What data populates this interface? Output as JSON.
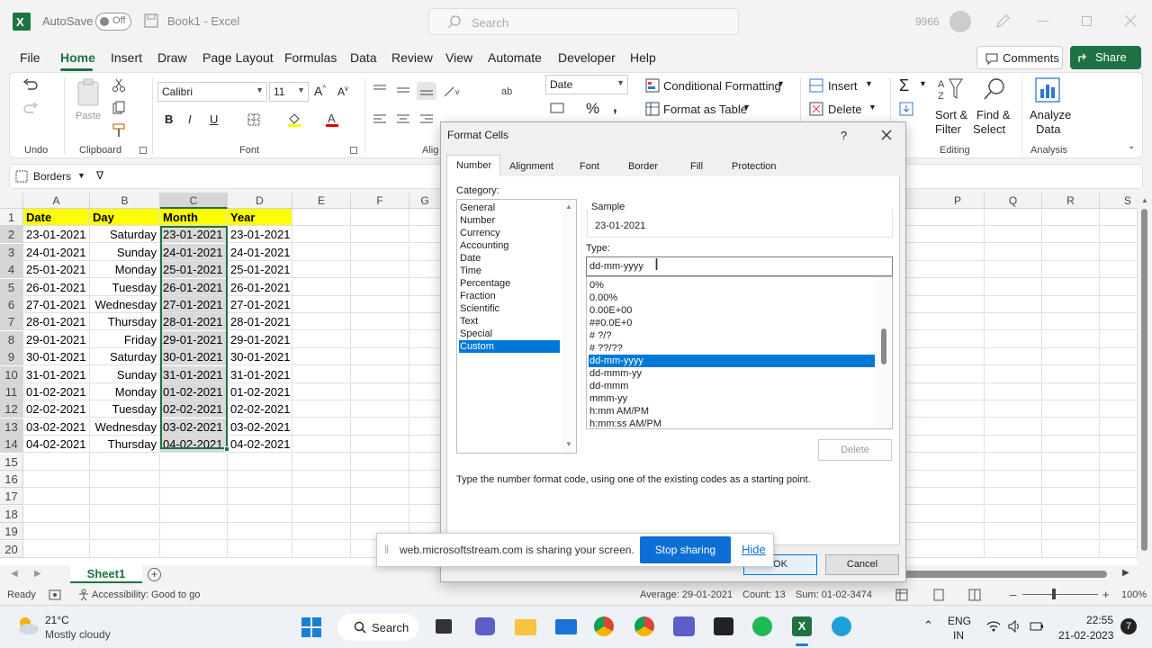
{
  "titlebar": {
    "autosave": "AutoSave",
    "toggle": "Off",
    "doc_title": "Book1 - Excel",
    "search_placeholder": "Search",
    "user_num": "9966"
  },
  "menu": [
    "File",
    "Home",
    "Insert",
    "Draw",
    "Page Layout",
    "Formulas",
    "Data",
    "Review",
    "View",
    "Automate",
    "Developer",
    "Help"
  ],
  "menu_right": {
    "comments": "Comments",
    "share": "Share"
  },
  "ribbon": {
    "undo_group": "Undo",
    "clipboard_group": "Clipboard",
    "paste": "Paste",
    "font_group": "Font",
    "font_name": "Calibri",
    "font_size": "11",
    "align_group": "Alig",
    "number_format": "Date",
    "cond_format": "Conditional Formatting",
    "format_table": "Format as Table",
    "insert": "Insert",
    "delete": "Delete",
    "sort_filter_1": "Sort &",
    "sort_filter_2": "Filter",
    "find_1": "Find &",
    "find_2": "Select",
    "editing_group": "Editing",
    "analyze_1": "Analyze",
    "analyze_2": "Data",
    "analysis_group": "Analysis",
    "bold": "B",
    "italic": "I",
    "underline": "U"
  },
  "formulabar": {
    "borders": "Borders"
  },
  "grid": {
    "columns": [
      "A",
      "B",
      "C",
      "D",
      "E",
      "F",
      "G",
      "P",
      "Q",
      "R",
      "S"
    ],
    "rows": [
      "1",
      "2",
      "3",
      "4",
      "5",
      "6",
      "7",
      "8",
      "9",
      "10",
      "11",
      "12",
      "13",
      "14",
      "15",
      "16",
      "17",
      "18",
      "19",
      "20"
    ],
    "headers": [
      "Date",
      "Day",
      "Month",
      "Year"
    ],
    "data": [
      [
        "23-01-2021",
        "Saturday",
        "23-01-2021",
        "23-01-2021"
      ],
      [
        "24-01-2021",
        "Sunday",
        "24-01-2021",
        "24-01-2021"
      ],
      [
        "25-01-2021",
        "Monday",
        "25-01-2021",
        "25-01-2021"
      ],
      [
        "26-01-2021",
        "Tuesday",
        "26-01-2021",
        "26-01-2021"
      ],
      [
        "27-01-2021",
        "Wednesday",
        "27-01-2021",
        "27-01-2021"
      ],
      [
        "28-01-2021",
        "Thursday",
        "28-01-2021",
        "28-01-2021"
      ],
      [
        "29-01-2021",
        "Friday",
        "29-01-2021",
        "29-01-2021"
      ],
      [
        "30-01-2021",
        "Saturday",
        "30-01-2021",
        "30-01-2021"
      ],
      [
        "31-01-2021",
        "Sunday",
        "31-01-2021",
        "31-01-2021"
      ],
      [
        "01-02-2021",
        "Monday",
        "01-02-2021",
        "01-02-2021"
      ],
      [
        "02-02-2021",
        "Tuesday",
        "02-02-2021",
        "02-02-2021"
      ],
      [
        "03-02-2021",
        "Wednesday",
        "03-02-2021",
        "03-02-2021"
      ],
      [
        "04-02-2021",
        "Thursday",
        "04-02-2021",
        "04-02-2021"
      ]
    ]
  },
  "dialog": {
    "title": "Format Cells",
    "help": "?",
    "tabs": [
      "Number",
      "Alignment",
      "Font",
      "Border",
      "Fill",
      "Protection"
    ],
    "category_label": "Category:",
    "categories": [
      "General",
      "Number",
      "Currency",
      "Accounting",
      "Date",
      "Time",
      "Percentage",
      "Fraction",
      "Scientific",
      "Text",
      "Special",
      "Custom"
    ],
    "selected_category": "Custom",
    "sample_label": "Sample",
    "sample_value": "23-01-2021",
    "type_label": "Type:",
    "type_value": "dd-mm-yyyy",
    "types": [
      "0%",
      "0.00%",
      "0.00E+00",
      "##0.0E+0",
      "# ?/?",
      "# ??/??",
      "dd-mm-yyyy",
      "dd-mmm-yy",
      "dd-mmm",
      "mmm-yy",
      "h:mm AM/PM",
      "h:mm:ss AM/PM"
    ],
    "selected_type": "dd-mm-yyyy",
    "delete": "Delete",
    "hint": "Type the number format code, using one of the existing codes as a starting point.",
    "ok": "OK",
    "cancel": "Cancel"
  },
  "share_banner": {
    "text": "web.microsoftstream.com is sharing your screen.",
    "stop": "Stop sharing",
    "hide": "Hide"
  },
  "sheet": {
    "tab": "Sheet1"
  },
  "status": {
    "ready": "Ready",
    "accessibility": "Accessibility: Good to go",
    "average": "Average: 29-01-2021",
    "count": "Count: 13",
    "sum": "Sum: 01-02-3474",
    "zoom": "100%"
  },
  "taskbar": {
    "temp": "21°C",
    "weather": "Mostly cloudy",
    "search": "Search",
    "lang1": "ENG",
    "lang2": "IN",
    "time": "22:55",
    "date": "21-02-2023",
    "badge": "7"
  },
  "colors": {
    "excel_green": "#1f7244",
    "accent_blue": "#0078d7",
    "yellow": "#ffff00"
  }
}
